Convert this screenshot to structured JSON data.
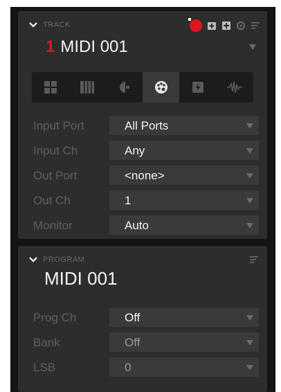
{
  "track": {
    "section_label": "TRACK",
    "number": "1",
    "name": "MIDI 001",
    "tabs": [
      {
        "icon": "pads-icon",
        "active": false
      },
      {
        "icon": "keyboard-icon",
        "active": false
      },
      {
        "icon": "chord-icon",
        "active": false
      },
      {
        "icon": "palette-icon",
        "active": true
      },
      {
        "icon": "plugin-icon",
        "active": false
      },
      {
        "icon": "waveform-icon",
        "active": false
      }
    ],
    "rows": [
      {
        "label": "Input Port",
        "value": "All Ports"
      },
      {
        "label": "Input Ch",
        "value": "Any"
      },
      {
        "label": "Out Port",
        "value": "<none>"
      },
      {
        "label": "Out Ch",
        "value": "1"
      },
      {
        "label": "Monitor",
        "value": "Auto"
      }
    ]
  },
  "program": {
    "section_label": "PROGRAM",
    "name": "MIDI 001",
    "rows": [
      {
        "label": "Prog Ch",
        "value": "Off"
      },
      {
        "label": "Bank",
        "value": "Off"
      },
      {
        "label": "LSB",
        "value": "0"
      }
    ]
  },
  "colors": {
    "accent": "#e0141e",
    "panel": "#2d2d2d",
    "field": "#3a3a3a",
    "label": "#5f5f5f"
  }
}
